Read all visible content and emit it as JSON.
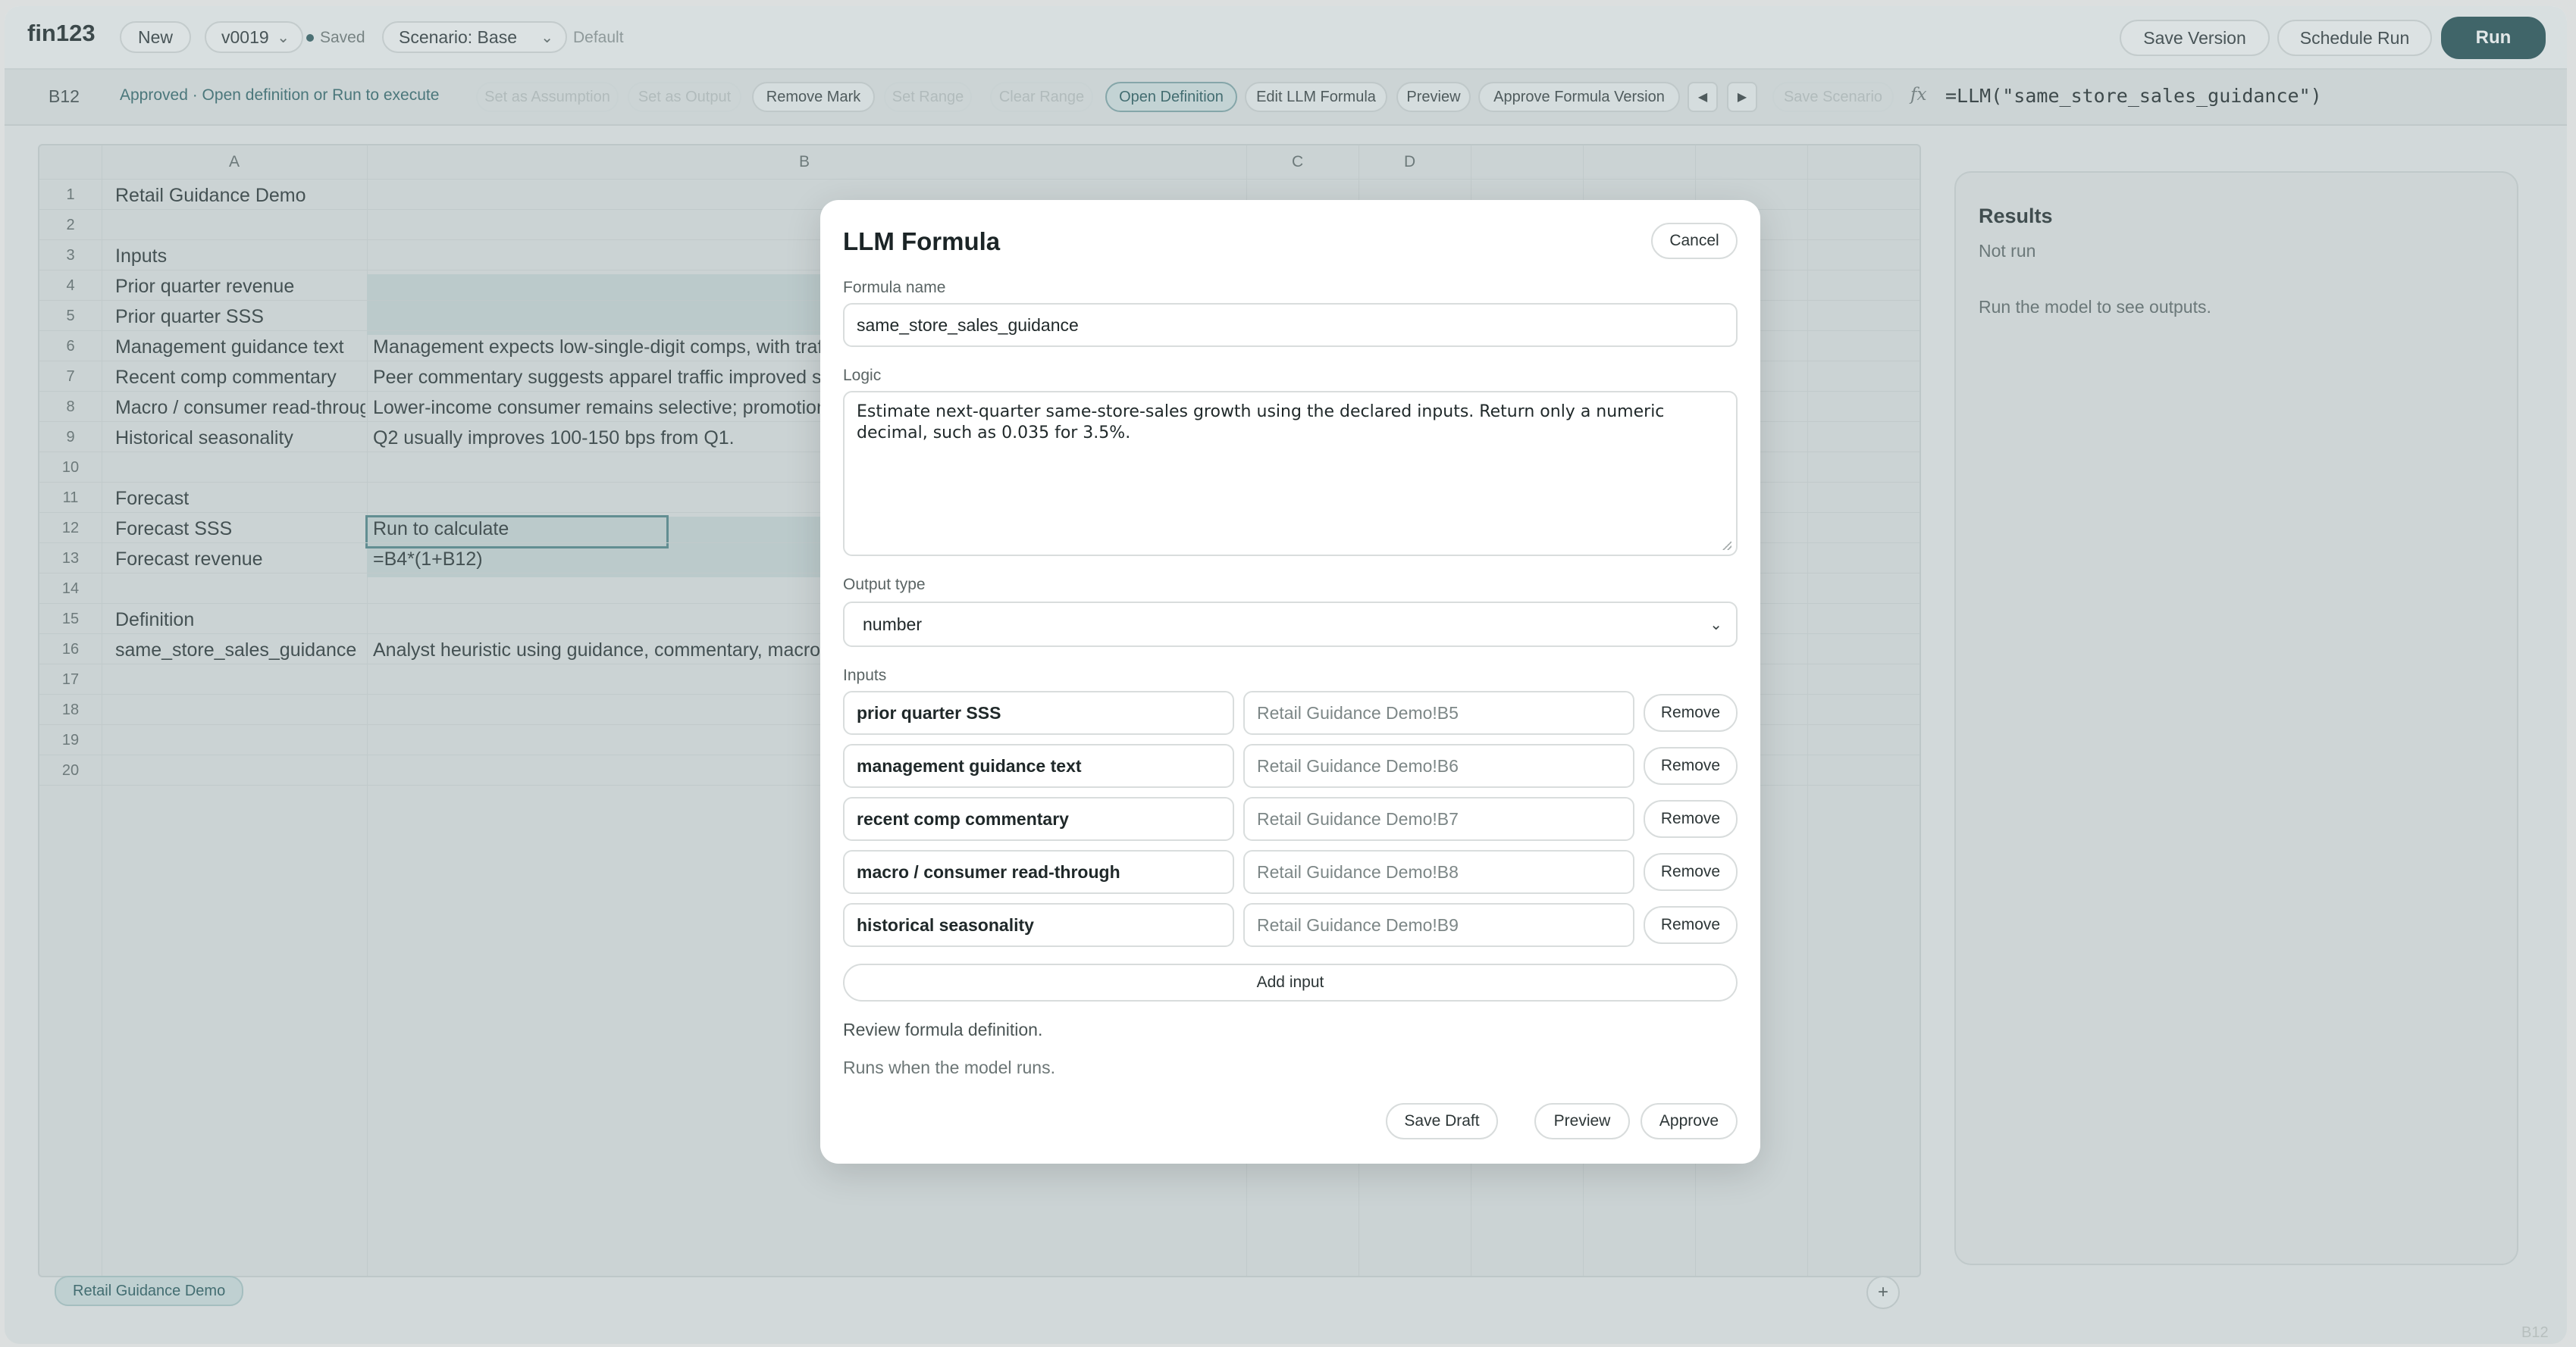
{
  "app": {
    "logo": "fin123",
    "new_label": "New",
    "version": "v0019",
    "saved_label": "Saved",
    "scenario": "Scenario: Base",
    "scenario_default": "Default",
    "save_version_label": "Save Version",
    "schedule_run_label": "Schedule Run",
    "run_label": "Run"
  },
  "toolbar": {
    "cell_ref": "B12",
    "status": "Approved · Open definition or Run to execute",
    "buttons": [
      {
        "label": "Set as Assumption",
        "state": "disabled"
      },
      {
        "label": "Set as Output",
        "state": "disabled"
      },
      {
        "label": "Remove Mark",
        "state": "normal"
      },
      {
        "label": "Set Range",
        "state": "disabled"
      },
      {
        "label": "Clear Range",
        "state": "disabled"
      },
      {
        "label": "Open Definition",
        "state": "active"
      },
      {
        "label": "Edit LLM Formula",
        "state": "normal"
      },
      {
        "label": "Preview",
        "state": "normal"
      },
      {
        "label": "Approve Formula Version",
        "state": "normal"
      }
    ],
    "prev_icon": "◀",
    "next_icon": "▶",
    "save_scenario_label": "Save Scenario",
    "fx": "fx",
    "formula": "=LLM(\"same_store_sales_guidance\")"
  },
  "grid": {
    "columns": [
      "A",
      "B",
      "C",
      "D"
    ],
    "rows": [
      "1",
      "2",
      "3",
      "4",
      "5",
      "6",
      "7",
      "8",
      "9",
      "10",
      "11",
      "12",
      "13",
      "14",
      "15",
      "16",
      "17",
      "18",
      "19",
      "20"
    ],
    "cells_a": {
      "1": "Retail Guidance Demo",
      "3": "Inputs",
      "4": "Prior quarter revenue",
      "5": "Prior quarter SSS",
      "6": "Management guidance text",
      "7": "Recent comp commentary",
      "8": "Macro / consumer read-through",
      "9": "Historical seasonality",
      "11": "Forecast",
      "12": "Forecast SSS",
      "13": "Forecast revenue",
      "15": "Definition",
      "16": "same_store_sales_guidance"
    },
    "cells_b": {
      "6": "Management expects low-single-digit comps, with traffic",
      "7": "Peer commentary suggests apparel traffic improved se",
      "8": "Lower-income consumer remains selective; promotions",
      "9": "Q2 usually improves 100-150 bps from Q1.",
      "12": "Run to calculate",
      "13": "=B4*(1+B12)",
      "16": "Analyst heuristic using guidance, commentary, macro r"
    }
  },
  "sheet_tab": "Retail Guidance Demo",
  "add_sheet_icon": "+",
  "results": {
    "title": "Results",
    "status": "Not run",
    "message": "Run the model to see outputs."
  },
  "corner_ref": "B12",
  "modal": {
    "title": "LLM Formula",
    "cancel_label": "Cancel",
    "name_label": "Formula name",
    "name_value": "same_store_sales_guidance",
    "logic_label": "Logic",
    "logic_value": "Estimate next-quarter same-store-sales growth using the declared inputs. Return only a numeric decimal, such as 0.035 for 3.5%.",
    "output_type_label": "Output type",
    "output_type_value": "number",
    "inputs_label": "Inputs",
    "inputs": [
      {
        "name": "prior quarter SSS",
        "ref": "Retail Guidance Demo!B5"
      },
      {
        "name": "management guidance text",
        "ref": "Retail Guidance Demo!B6"
      },
      {
        "name": "recent comp commentary",
        "ref": "Retail Guidance Demo!B7"
      },
      {
        "name": "macro / consumer read-through",
        "ref": "Retail Guidance Demo!B8"
      },
      {
        "name": "historical seasonality",
        "ref": "Retail Guidance Demo!B9"
      }
    ],
    "remove_label": "Remove",
    "add_input_label": "Add input",
    "review_note": "Review formula definition.",
    "runs_note": "Runs when the model runs.",
    "save_draft_label": "Save Draft",
    "preview_label": "Preview",
    "approve_label": "Approve"
  }
}
